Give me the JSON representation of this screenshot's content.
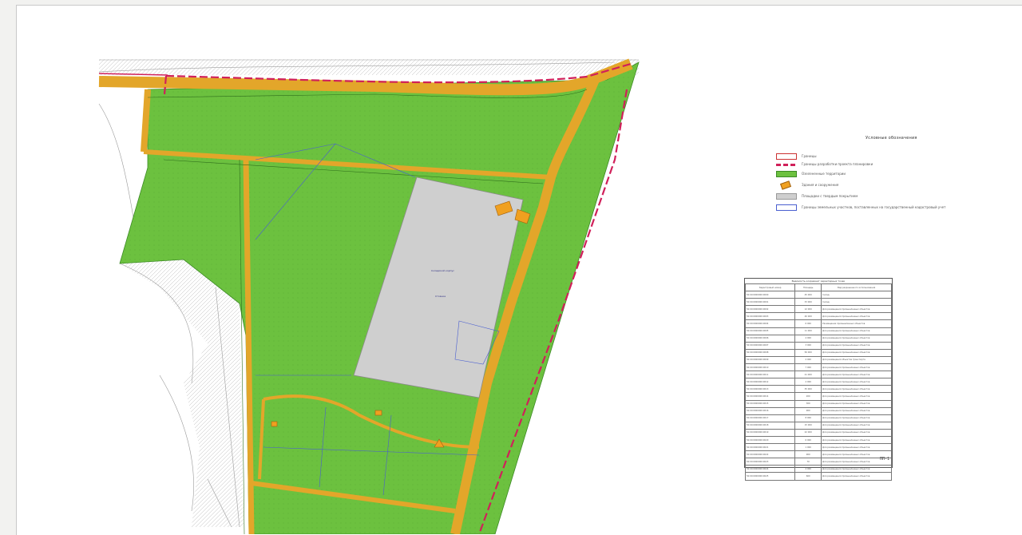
{
  "colors": {
    "green": "#6cc13f",
    "green_dark": "#3c8a25",
    "road": "#e3a62a",
    "hard_surface": "#cfcfcf",
    "red_line": "#d0205a",
    "parcel": "#4a5fd0",
    "building": "#f0a020"
  },
  "legend": {
    "title": "Условные обозначения",
    "items": [
      {
        "label": "Границы",
        "swatch": "boundary"
      },
      {
        "label": "Границы разработки проекта планировки",
        "swatch": "red-dashed"
      },
      {
        "label": "Озелененные территории",
        "swatch": "green"
      },
      {
        "label": "Здания и сооружения",
        "swatch": "building"
      },
      {
        "label": "Площадки с твердым покрытием",
        "swatch": "hard-surface"
      },
      {
        "label": "Границы земельных участков, поставленных на государственный кадастровый учет",
        "swatch": "parcel"
      }
    ]
  },
  "table": {
    "title": "Ведомость координат характерных точек",
    "headers": [
      "Кадастровый номер",
      "Площадь",
      "Вид разрешенного использования"
    ],
    "rows": [
      [
        "50:00:0000000:0000",
        "45 000",
        "Склад"
      ],
      [
        "50:00:0000000:0001",
        "33 000",
        "Склад"
      ],
      [
        "50:00:0000000:0002",
        "12 000",
        "Для размещения промышленных объектов"
      ],
      [
        "50:00:0000000:0003",
        "40 000",
        "Для размещения промышленных объектов"
      ],
      [
        "50:00:0000000:0004",
        "6 000",
        "Размещение промышленных объектов"
      ],
      [
        "50:00:0000000:0005",
        "11 000",
        "Для размещения промышленных объектов"
      ],
      [
        "50:00:0000000:0006",
        "4 000",
        "Для размещения промышленных объектов"
      ],
      [
        "50:00:0000000:0007",
        "3 000",
        "Для размещения промышленных объектов"
      ],
      [
        "50:00:0000000:0008",
        "56 000",
        "Для размещения промышленных объектов"
      ],
      [
        "50:00:0000000:0009",
        "2 000",
        "Для размещения объектов транспорта"
      ],
      [
        "50:00:0000000:0010",
        "7 000",
        "Для размещения промышленных объектов"
      ],
      [
        "50:00:0000000:0011",
        "21 000",
        "Для размещения промышленных объектов"
      ],
      [
        "50:00:0000000:0012",
        "2 000",
        "Для размещения промышленных объектов"
      ],
      [
        "50:00:0000000:0013",
        "35 000",
        "Для размещения промышленных объектов"
      ],
      [
        "50:00:0000000:0014",
        "200",
        "Для размещения промышленных объектов"
      ],
      [
        "50:00:0000000:0015",
        "300",
        "Для размещения промышленных объектов"
      ],
      [
        "50:00:0000000:0016",
        "900",
        "Для размещения промышленных объектов"
      ],
      [
        "50:00:0000000:0017",
        "8 000",
        "Для размещения промышленных объектов"
      ],
      [
        "50:00:0000000:0018",
        "15 000",
        "Для размещения промышленных объектов"
      ],
      [
        "50:00:0000000:0019",
        "22 000",
        "Для размещения промышленных объектов"
      ],
      [
        "50:00:0000000:0020",
        "6 000",
        "Для размещения промышленных объектов"
      ],
      [
        "50:00:0000000:0021",
        "1 000",
        "Для размещения промышленных объектов"
      ],
      [
        "50:00:0000000:0022",
        "900",
        "Для размещения промышленных объектов"
      ],
      [
        "50:00:0000000:0023",
        "70",
        "Для размещения промышленных объектов"
      ],
      [
        "50:00:0000000:0024",
        "4 000",
        "Для размещения промышленных объектов"
      ],
      [
        "50:00:0000000:0025",
        "600",
        "Для размещения промышленных объектов"
      ]
    ]
  },
  "stamp": {
    "sheet": "ПП-1"
  },
  "map_labels": {
    "warehouse": "Складской корпус",
    "parking": "Стоянка"
  }
}
